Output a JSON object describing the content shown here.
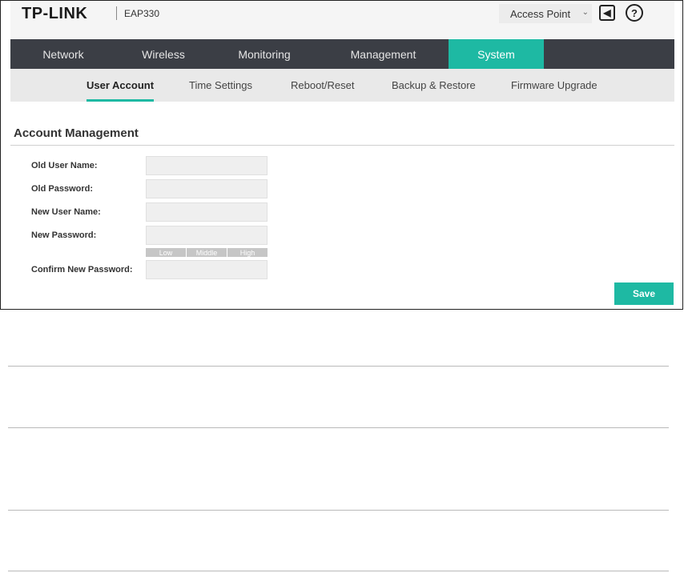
{
  "header": {
    "brand": "TP-LINK",
    "model": "EAP330",
    "mode_selected": "Access Point",
    "logout_icon": "logout-icon",
    "help_icon": "help-icon",
    "help_glyph": "?"
  },
  "main_nav": {
    "tabs": [
      {
        "label": "Network"
      },
      {
        "label": "Wireless"
      },
      {
        "label": "Monitoring"
      },
      {
        "label": "Management"
      },
      {
        "label": "System"
      }
    ],
    "active": "System"
  },
  "sub_nav": {
    "tabs": [
      {
        "label": "User Account"
      },
      {
        "label": "Time Settings"
      },
      {
        "label": "Reboot/Reset"
      },
      {
        "label": "Backup & Restore"
      },
      {
        "label": "Firmware Upgrade"
      }
    ],
    "active": "User Account"
  },
  "account": {
    "title": "Account Management",
    "old_user_name": {
      "label": "Old User Name:",
      "value": ""
    },
    "old_password": {
      "label": "Old Password:",
      "value": ""
    },
    "new_user_name": {
      "label": "New User Name:",
      "value": ""
    },
    "new_password": {
      "label": "New Password:",
      "value": ""
    },
    "confirm_password": {
      "label": "Confirm New Password:",
      "value": ""
    },
    "strength": {
      "low": "Low",
      "middle": "Middle",
      "high": "High"
    },
    "save_label": "Save"
  },
  "colors": {
    "accent": "#1eb9a3",
    "nav_bg": "#3b3e45",
    "subnav_bg": "#e9e9e9"
  }
}
